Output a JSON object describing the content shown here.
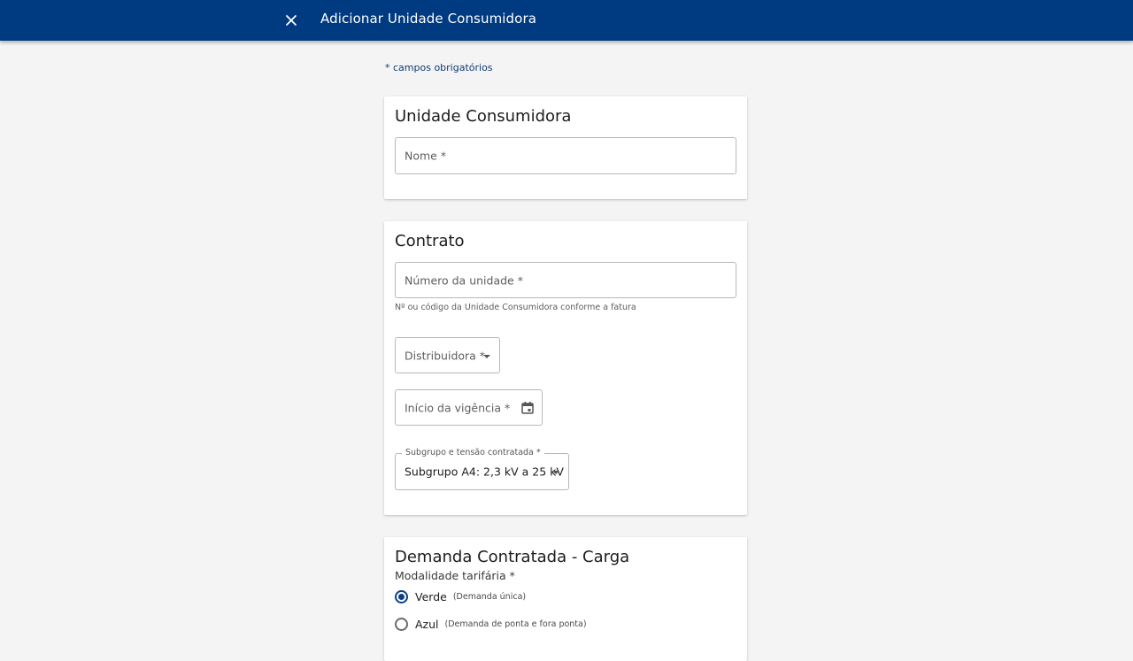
{
  "header": {
    "title": "Adicionar Unidade Consumidora",
    "close_icon": "close-icon"
  },
  "form": {
    "required_note": "* campos obrigatórios"
  },
  "unit_section": {
    "title": "Unidade Consumidora",
    "name_placeholder": "Nome *"
  },
  "contract_section": {
    "title": "Contrato",
    "unit_number_placeholder": "Número da unidade *",
    "unit_number_helper": "Nº ou código da Unidade Consumidora conforme a fatura",
    "distributor_placeholder": "Distribuidora *",
    "start_date_placeholder": "Início da vigência *",
    "calendar_icon": "calendar-icon",
    "subgroup_label": "Subgrupo e tensão contratada *",
    "subgroup_value": "Subgrupo A4: 2,3 kV a 25 kV"
  },
  "demand_section": {
    "title": "Demanda Contratada - Carga",
    "modality_label": "Modalidade tarifária *",
    "options": [
      {
        "label": "Verde",
        "description": "(Demanda única)",
        "selected": true
      },
      {
        "label": "Azul",
        "description": "(Demanda de ponta e fora ponta)",
        "selected": false
      }
    ]
  },
  "colors": {
    "header_bg": "#003a80",
    "accent": "#0b3f86",
    "page_bg": "#f4f4f4"
  }
}
